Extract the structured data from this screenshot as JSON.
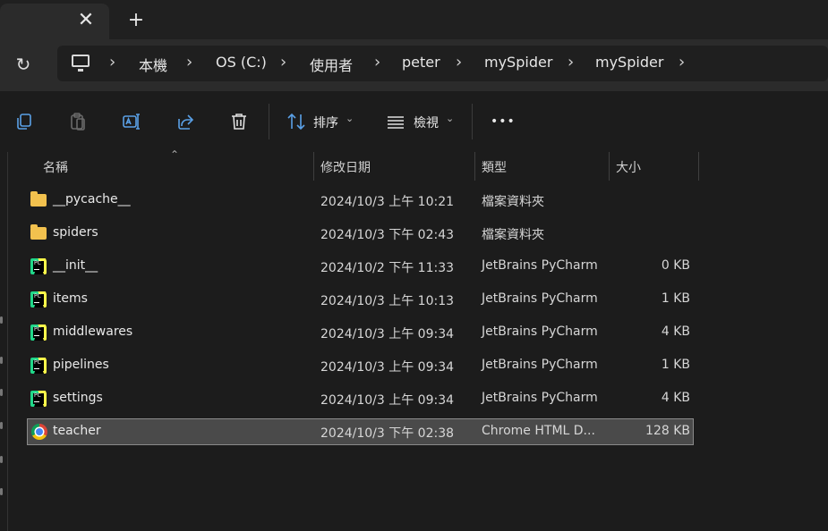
{
  "tabs": {
    "close_glyph": "✕",
    "new_tab_glyph": "+"
  },
  "address": {
    "refresh_glyph": "↻",
    "crumbs": [
      "本機",
      "OS (C:)",
      "使用者",
      "peter",
      "mySpider",
      "mySpider"
    ],
    "separator": "›"
  },
  "toolbar": {
    "sort_label": "排序",
    "view_label": "檢視",
    "more_label": "•••",
    "caret": "⌄"
  },
  "columns": {
    "name": "名稱",
    "date": "修改日期",
    "type": "類型",
    "size": "大小",
    "sort_arrow": "⌃"
  },
  "files": [
    {
      "name": "__pycache__",
      "date": "2024/10/3 上午 10:21",
      "type": "檔案資料夾",
      "size": "",
      "icon": "folder-icon"
    },
    {
      "name": "spiders",
      "date": "2024/10/3 下午 02:43",
      "type": "檔案資料夾",
      "size": "",
      "icon": "folder-icon"
    },
    {
      "name": "__init__",
      "date": "2024/10/2 下午 11:33",
      "type": "JetBrains PyCharm",
      "size": "0 KB",
      "icon": "pycharm-icon"
    },
    {
      "name": "items",
      "date": "2024/10/3 上午 10:13",
      "type": "JetBrains PyCharm",
      "size": "1 KB",
      "icon": "pycharm-icon"
    },
    {
      "name": "middlewares",
      "date": "2024/10/3 上午 09:34",
      "type": "JetBrains PyCharm",
      "size": "4 KB",
      "icon": "pycharm-icon"
    },
    {
      "name": "pipelines",
      "date": "2024/10/3 上午 09:34",
      "type": "JetBrains PyCharm",
      "size": "1 KB",
      "icon": "pycharm-icon"
    },
    {
      "name": "settings",
      "date": "2024/10/3 上午 09:34",
      "type": "JetBrains PyCharm",
      "size": "4 KB",
      "icon": "pycharm-icon"
    },
    {
      "name": "teacher",
      "date": "2024/10/3 下午 02:38",
      "type": "Chrome HTML D...",
      "size": "128 KB",
      "icon": "chrome-icon",
      "selected": true
    }
  ],
  "colors": {
    "background": "#1c1c1c",
    "folder": "#f2c14e",
    "selection": "#4a4a4a"
  }
}
